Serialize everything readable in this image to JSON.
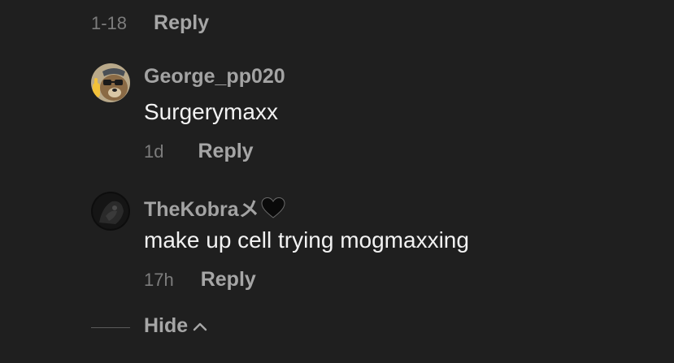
{
  "top_comment": {
    "time": "1-18",
    "reply_label": "Reply"
  },
  "comments": [
    {
      "username": "George_pp020",
      "text": "Surgerymaxx",
      "time": "1d",
      "reply_label": "Reply"
    },
    {
      "username": "TheKobraメ",
      "text": "make up cell trying mogmaxxing",
      "time": "17h",
      "reply_label": "Reply"
    }
  ],
  "hide": {
    "label": "Hide"
  }
}
